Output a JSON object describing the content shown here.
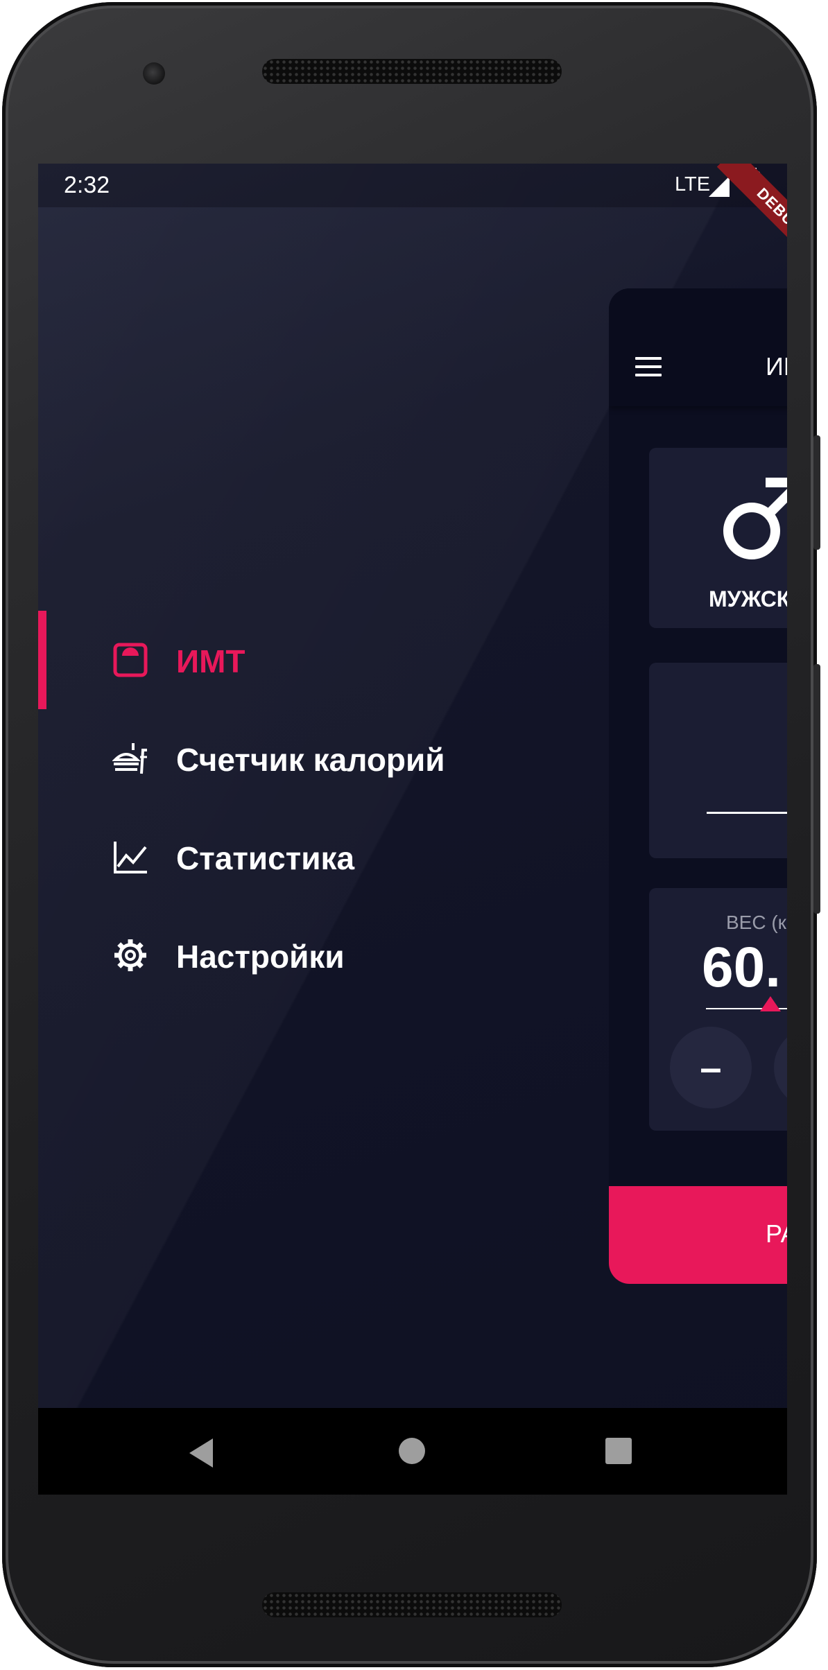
{
  "status_bar": {
    "time": "2:32",
    "network": "LTE",
    "debug_banner": "DEBUG"
  },
  "drawer": {
    "items": [
      {
        "label": "ИМТ",
        "icon": "scale-icon",
        "active": true
      },
      {
        "label": "Счетчик калорий",
        "icon": "food-counter-icon",
        "active": false
      },
      {
        "label": "Статистика",
        "icon": "line-chart-icon",
        "active": false
      },
      {
        "label": "Настройки",
        "icon": "gear-icon",
        "active": false
      }
    ]
  },
  "app": {
    "title": "ИМ",
    "gender_label": "МУЖСК",
    "weight_caption": "ВЕС (ки",
    "weight_value": "60.",
    "minus_label": "–",
    "calculate_label": "РА"
  },
  "colors": {
    "accent": "#e8185a",
    "background": "#111326",
    "card": "#1b1d33"
  }
}
